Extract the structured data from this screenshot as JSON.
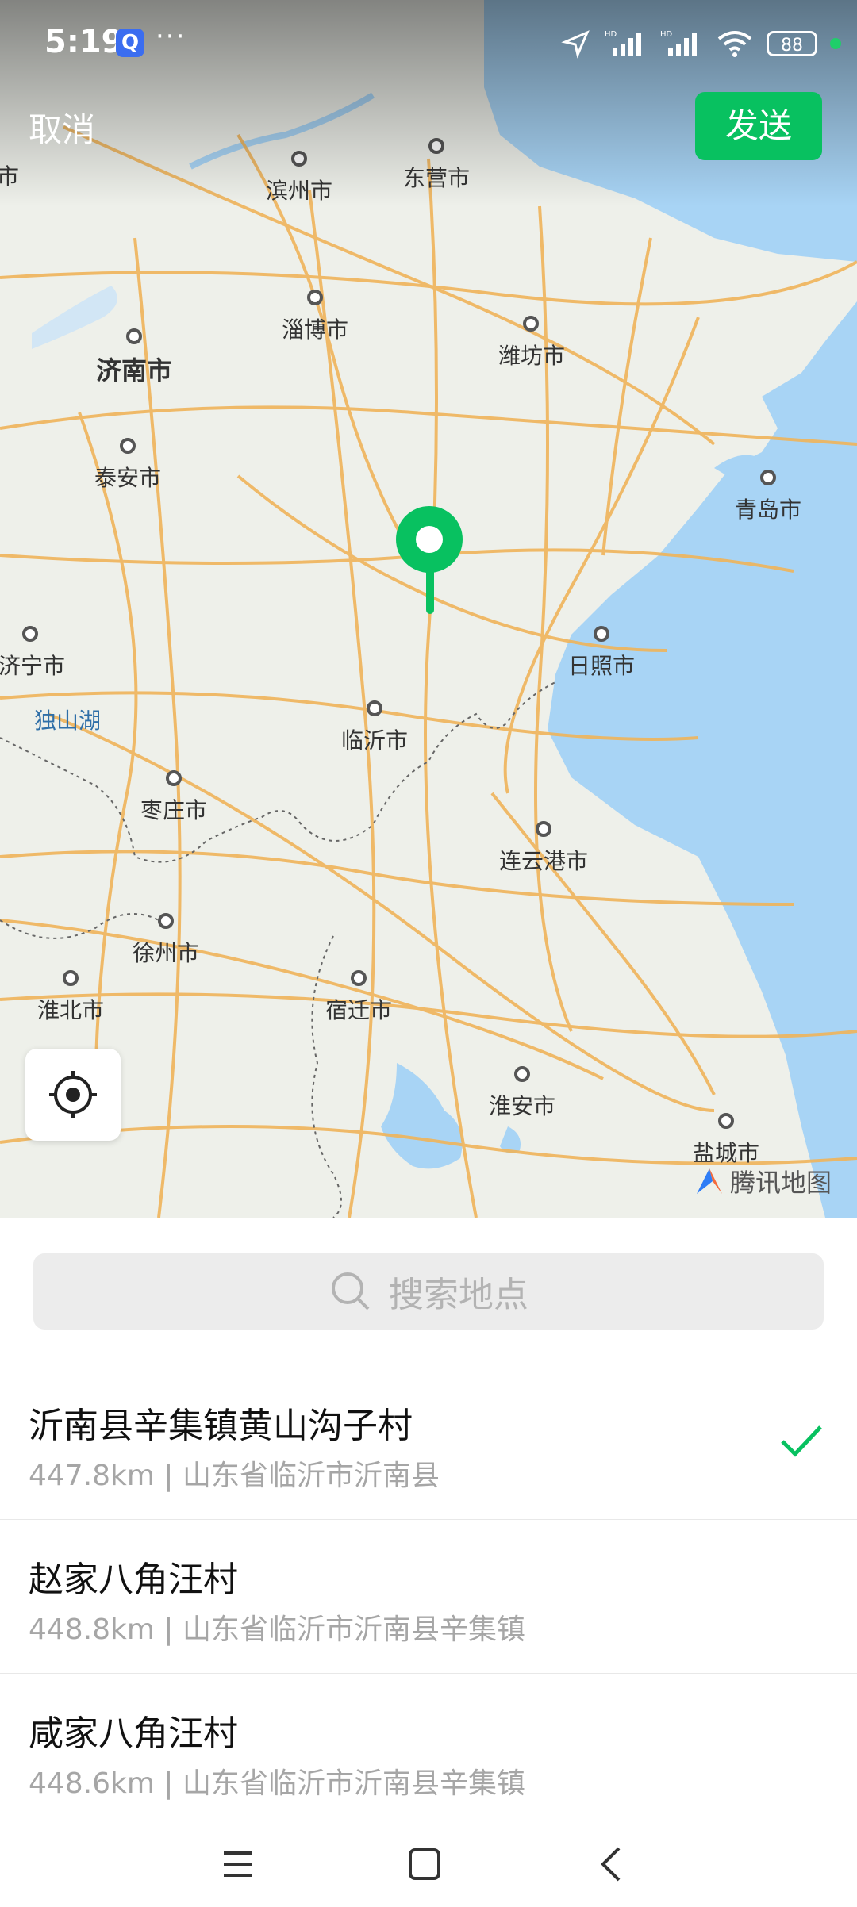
{
  "status": {
    "time": "5:19",
    "q_badge": "Q",
    "more": "···",
    "battery": "88"
  },
  "header": {
    "cancel_label": "取消",
    "send_label": "发送"
  },
  "map": {
    "cities": [
      "滨州市",
      "东营市",
      "淄博市",
      "潍坊市",
      "济南市",
      "泰安市",
      "青岛市",
      "济宁市",
      "日照市",
      "临沂市",
      "枣庄市",
      "连云港市",
      "徐州市",
      "淮北市",
      "宿迁市",
      "淮安市",
      "盐城市"
    ],
    "left_edge_city": "市",
    "lake_label": "独山湖",
    "provider_logo": "腾讯地图",
    "pin_color": "#08c160"
  },
  "search": {
    "placeholder": "搜索地点"
  },
  "results": [
    {
      "name": "沂南县辛集镇黄山沟子村",
      "detail": "447.8km | 山东省临沂市沂南县",
      "selected": true
    },
    {
      "name": "赵家八角汪村",
      "detail": "448.8km | 山东省临沂市沂南县辛集镇",
      "selected": false
    },
    {
      "name": "咸家八角汪村",
      "detail": "448.6km | 山东省临沂市沂南县辛集镇",
      "selected": false
    }
  ],
  "colors": {
    "accent": "#08c160",
    "water": "#a8d4f5",
    "road": "#f0b45a"
  }
}
